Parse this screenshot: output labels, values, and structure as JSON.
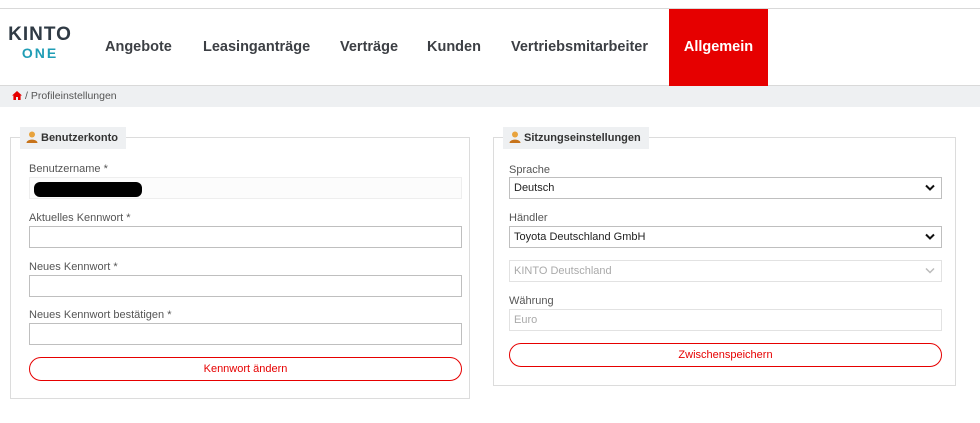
{
  "logo": {
    "line1": "KINTO",
    "line2": "ONE"
  },
  "nav": {
    "items": [
      {
        "label": "Angebote"
      },
      {
        "label": "Leasinganträge"
      },
      {
        "label": "Verträge"
      },
      {
        "label": "Kunden"
      },
      {
        "label": "Vertriebsmitarbeiter"
      },
      {
        "label": "Allgemein",
        "active": true
      }
    ]
  },
  "breadcrumb": {
    "separator": "/",
    "current": "Profileinstellungen"
  },
  "account": {
    "title": "Benutzerkonto",
    "username_label": "Benutzername *",
    "current_pw_label": "Aktuelles Kennwort *",
    "current_pw_value": "",
    "new_pw_label": "Neues Kennwort *",
    "new_pw_value": "",
    "confirm_pw_label": "Neues Kennwort bestätigen *",
    "confirm_pw_value": "",
    "change_button": "Kennwort ändern"
  },
  "session": {
    "title": "Sitzungseinstellungen",
    "language_label": "Sprache",
    "language_value": "Deutsch",
    "dealer_label": "Händler",
    "dealer_value": "Toyota Deutschland GmbH",
    "org_value": "KINTO Deutschland",
    "currency_label": "Währung",
    "currency_value": "Euro",
    "save_button": "Zwischenspeichern"
  },
  "colors": {
    "accent": "#e60000",
    "logo_dark": "#2f3a44",
    "logo_teal": "#1f9db5"
  },
  "icons": {
    "home": "home-icon",
    "user": "user-icon",
    "dropdown": "chevron-down-icon"
  }
}
